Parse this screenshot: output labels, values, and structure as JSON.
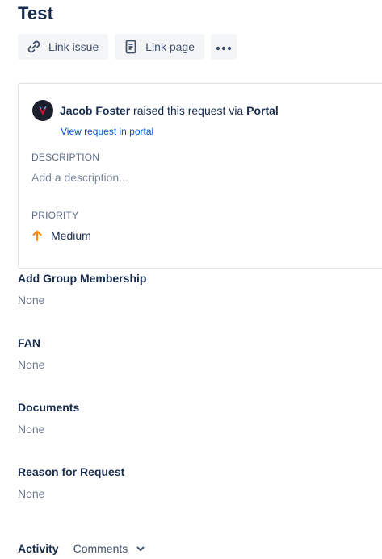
{
  "issue": {
    "title": "Test"
  },
  "toolbar": {
    "link_issue_label": "Link issue",
    "link_page_label": "Link page",
    "more_icon": "more-icon"
  },
  "request": {
    "requester_name": "Jacob Foster",
    "raised_text": " raised this request via ",
    "channel": "Portal",
    "view_link": "View request in portal",
    "description_label": "DESCRIPTION",
    "description_placeholder": "Add a description...",
    "priority_label": "PRIORITY",
    "priority_value": "Medium",
    "priority_color": "#ff8b00"
  },
  "fields": [
    {
      "label": "Add Group Membership",
      "value": "None"
    },
    {
      "label": "FAN",
      "value": "None"
    },
    {
      "label": "Documents",
      "value": "None"
    },
    {
      "label": "Reason for Request",
      "value": "None"
    }
  ],
  "activity": {
    "label": "Activity",
    "filter": "Comments"
  }
}
